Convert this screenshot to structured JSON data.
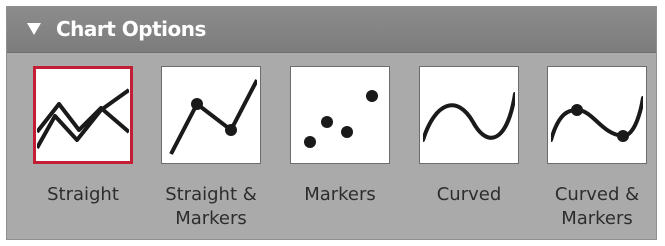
{
  "panel": {
    "title": "Chart Options",
    "toggle_icon": "triangle-down-icon"
  },
  "options": [
    {
      "id": "straight",
      "label": "Straight",
      "icon": "straight-lines-icon",
      "selected": true
    },
    {
      "id": "straight-markers",
      "label": "Straight &\nMarkers",
      "icon": "straight-lines-markers-icon",
      "selected": false
    },
    {
      "id": "markers",
      "label": "Markers",
      "icon": "markers-icon",
      "selected": false
    },
    {
      "id": "curved",
      "label": "Curved",
      "icon": "curved-line-icon",
      "selected": false
    },
    {
      "id": "curved-markers",
      "label": "Curved &\nMarkers",
      "icon": "curved-line-markers-icon",
      "selected": false
    }
  ],
  "colors": {
    "selected_border": "#c41e35",
    "panel_bg": "#aaaaaa",
    "header_bg": "#808080",
    "stroke": "#1a1a1a"
  }
}
